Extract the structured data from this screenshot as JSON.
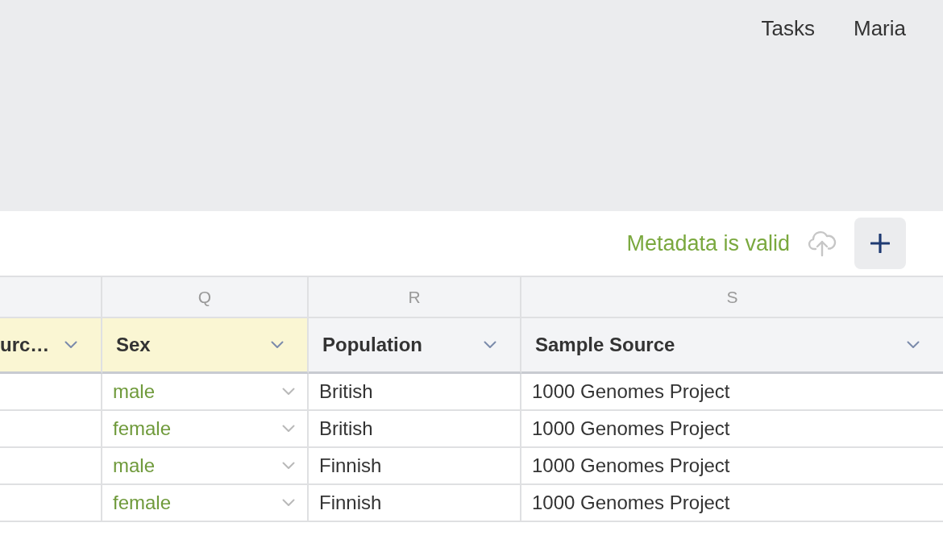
{
  "top_nav": {
    "links": [
      "Tasks",
      "Maria"
    ]
  },
  "toolbar": {
    "validation": {
      "text": "Metadata is valid",
      "valid": true
    },
    "upload_disabled": true
  },
  "table": {
    "columns": [
      {
        "header": "urc…",
        "highlighted": true,
        "kind": "text"
      },
      {
        "letter": "Q",
        "header": "Sex",
        "highlighted": true,
        "kind": "dropdown"
      },
      {
        "letter": "R",
        "header": "Population",
        "highlighted": false,
        "kind": "text"
      },
      {
        "letter": "S",
        "header": "Sample Source",
        "highlighted": false,
        "kind": "text"
      }
    ],
    "rows": [
      [
        null,
        "male",
        "British",
        "1000 Genomes Project"
      ],
      [
        null,
        "female",
        "British",
        "1000 Genomes Project"
      ],
      [
        null,
        "male",
        "Finnish",
        "1000 Genomes Project"
      ],
      [
        null,
        "female",
        "Finnish",
        "1000 Genomes Project"
      ]
    ]
  }
}
